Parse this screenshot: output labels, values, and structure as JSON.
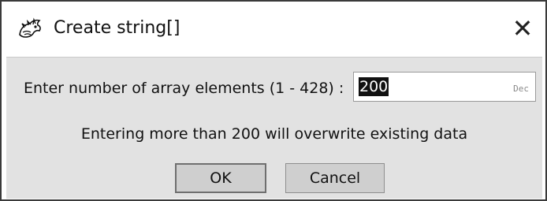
{
  "window": {
    "title": "Create string[]",
    "app_icon": "dragon-icon",
    "close_glyph": "✕"
  },
  "form": {
    "prompt": "Enter number of array elements (1 - 428) :",
    "value": "200",
    "base_label": "Dec",
    "warning": "Entering more than 200 will overwrite existing data"
  },
  "buttons": {
    "ok_label": "OK",
    "cancel_label": "Cancel"
  },
  "colors": {
    "content_background": "#e2e2e2",
    "selection_background": "#111111",
    "button_face": "#cfcfcf"
  }
}
